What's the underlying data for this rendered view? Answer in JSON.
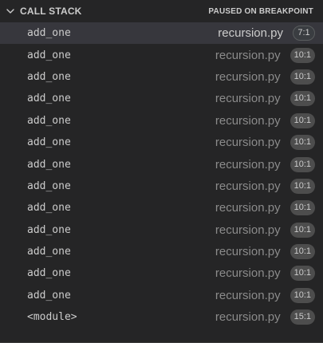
{
  "header": {
    "title": "CALL STACK",
    "status": "PAUSED ON BREAKPOINT",
    "chevron_icon": "chevron-down-icon"
  },
  "frames": [
    {
      "function": "add_one",
      "file": "recursion.py",
      "position": "7:1",
      "selected": true
    },
    {
      "function": "add_one",
      "file": "recursion.py",
      "position": "10:1"
    },
    {
      "function": "add_one",
      "file": "recursion.py",
      "position": "10:1"
    },
    {
      "function": "add_one",
      "file": "recursion.py",
      "position": "10:1"
    },
    {
      "function": "add_one",
      "file": "recursion.py",
      "position": "10:1"
    },
    {
      "function": "add_one",
      "file": "recursion.py",
      "position": "10:1"
    },
    {
      "function": "add_one",
      "file": "recursion.py",
      "position": "10:1"
    },
    {
      "function": "add_one",
      "file": "recursion.py",
      "position": "10:1"
    },
    {
      "function": "add_one",
      "file": "recursion.py",
      "position": "10:1"
    },
    {
      "function": "add_one",
      "file": "recursion.py",
      "position": "10:1"
    },
    {
      "function": "add_one",
      "file": "recursion.py",
      "position": "10:1"
    },
    {
      "function": "add_one",
      "file": "recursion.py",
      "position": "10:1"
    },
    {
      "function": "add_one",
      "file": "recursion.py",
      "position": "10:1"
    },
    {
      "function": "<module>",
      "file": "recursion.py",
      "position": "15:1"
    }
  ],
  "colors": {
    "background": "#252526",
    "selected_row": "#37373d",
    "text": "#cccccc",
    "muted_text": "#8b8b8b",
    "badge": "#4d4d4d"
  }
}
